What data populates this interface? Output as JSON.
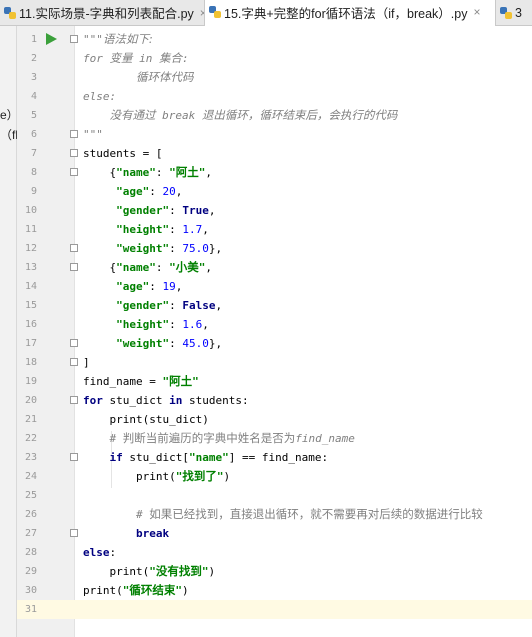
{
  "tabs": [
    {
      "label": "11.实际场景-字典和列表配合.py",
      "close": "×",
      "active": false
    },
    {
      "label": "15.字典+完整的for循环语法（if，break）.py",
      "close": "×",
      "active": true
    },
    {
      "label": "3",
      "active": false
    }
  ],
  "left_panel": {
    "fragments": [
      "e）",
      "（fl"
    ]
  },
  "colors": {
    "keyword": "#000080",
    "string": "#008000",
    "dict_key": "#660099",
    "number": "#0000ff",
    "comment": "#808080",
    "current_line": "#fffae3",
    "run_arrow": "#3ba03b"
  },
  "icons": [
    "python-file-icon",
    "run-arrow-icon",
    "fold-icon"
  ],
  "editor": {
    "current_line": 31,
    "lines": [
      {
        "n": "1",
        "t": [
          [
            "doc",
            "\"\"\""
          ],
          [
            "doc cjk",
            "语法如下:"
          ]
        ]
      },
      {
        "n": "2",
        "t": [
          [
            "doc",
            "for "
          ],
          [
            "doc cjk",
            "变量"
          ],
          [
            "doc",
            " in "
          ],
          [
            "doc cjk",
            "集合"
          ],
          [
            "doc",
            ":"
          ]
        ]
      },
      {
        "n": "3",
        "t": [
          [
            "doc",
            "        "
          ],
          [
            "doc cjk",
            "循环体代码"
          ]
        ]
      },
      {
        "n": "4",
        "t": [
          [
            "doc",
            "else:"
          ]
        ]
      },
      {
        "n": "5",
        "t": [
          [
            "doc",
            "    "
          ],
          [
            "doc cjk",
            "没有通过"
          ],
          [
            "doc",
            " break "
          ],
          [
            "doc cjk",
            "退出循环，循环结束后，会执行的代码"
          ]
        ]
      },
      {
        "n": "6",
        "t": [
          [
            "doc",
            "\"\"\""
          ]
        ]
      },
      {
        "n": "7",
        "t": [
          [
            "",
            "students = ["
          ]
        ]
      },
      {
        "n": "8",
        "t": [
          [
            "",
            "    {"
          ],
          [
            "str",
            "\"name\""
          ],
          [
            "",
            ": "
          ],
          [
            "str",
            "\""
          ],
          [
            "str cjk",
            "阿土"
          ],
          [
            "str",
            "\""
          ],
          [
            "",
            ","
          ]
        ]
      },
      {
        "n": "9",
        "t": [
          [
            "",
            "     "
          ],
          [
            "str",
            "\"age\""
          ],
          [
            "",
            ": "
          ],
          [
            "num",
            "20"
          ],
          [
            "",
            ","
          ]
        ]
      },
      {
        "n": "10",
        "t": [
          [
            "",
            "     "
          ],
          [
            "str",
            "\"gender\""
          ],
          [
            "",
            ": "
          ],
          [
            "kw",
            "True"
          ],
          [
            "",
            ","
          ]
        ]
      },
      {
        "n": "11",
        "t": [
          [
            "",
            "     "
          ],
          [
            "str",
            "\"height\""
          ],
          [
            "",
            ": "
          ],
          [
            "num",
            "1.7"
          ],
          [
            "",
            ","
          ]
        ]
      },
      {
        "n": "12",
        "t": [
          [
            "",
            "     "
          ],
          [
            "str",
            "\"weight\""
          ],
          [
            "",
            ": "
          ],
          [
            "num",
            "75.0"
          ],
          [
            "",
            "},"
          ]
        ]
      },
      {
        "n": "13",
        "t": [
          [
            "",
            "    {"
          ],
          [
            "str",
            "\"name\""
          ],
          [
            "",
            ": "
          ],
          [
            "str",
            "\""
          ],
          [
            "str cjk",
            "小美"
          ],
          [
            "str",
            "\""
          ],
          [
            "",
            ","
          ]
        ]
      },
      {
        "n": "14",
        "t": [
          [
            "",
            "     "
          ],
          [
            "str",
            "\"age\""
          ],
          [
            "",
            ": "
          ],
          [
            "num",
            "19"
          ],
          [
            "",
            ","
          ]
        ]
      },
      {
        "n": "15",
        "t": [
          [
            "",
            "     "
          ],
          [
            "str",
            "\"gender\""
          ],
          [
            "",
            ": "
          ],
          [
            "kw",
            "False"
          ],
          [
            "",
            ","
          ]
        ]
      },
      {
        "n": "16",
        "t": [
          [
            "",
            "     "
          ],
          [
            "str",
            "\"height\""
          ],
          [
            "",
            ": "
          ],
          [
            "num",
            "1.6"
          ],
          [
            "",
            ","
          ]
        ]
      },
      {
        "n": "17",
        "t": [
          [
            "",
            "     "
          ],
          [
            "str",
            "\"weight\""
          ],
          [
            "",
            ": "
          ],
          [
            "num",
            "45.0"
          ],
          [
            "",
            "},"
          ]
        ]
      },
      {
        "n": "18",
        "t": [
          [
            "",
            "]"
          ]
        ]
      },
      {
        "n": "19",
        "t": [
          [
            "",
            "find_name = "
          ],
          [
            "str",
            "\""
          ],
          [
            "str cjk",
            "阿土"
          ],
          [
            "str",
            "\""
          ]
        ]
      },
      {
        "n": "20",
        "t": [
          [
            "kw",
            "for"
          ],
          [
            "",
            " stu_dict "
          ],
          [
            "kw",
            "in"
          ],
          [
            "",
            " students:"
          ]
        ]
      },
      {
        "n": "21",
        "t": [
          [
            "",
            "    print(stu_dict)"
          ]
        ]
      },
      {
        "n": "22",
        "t": [
          [
            "cmt",
            "    # "
          ],
          [
            "cmt cjk",
            "判断当前遍历的字典中姓名是否为"
          ],
          [
            "cmt it",
            "find_name"
          ]
        ]
      },
      {
        "n": "23",
        "t": [
          [
            "",
            "    "
          ],
          [
            "kw",
            "if"
          ],
          [
            "",
            " stu_dict["
          ],
          [
            "str",
            "\"name\""
          ],
          [
            "",
            "] == find_name:"
          ]
        ]
      },
      {
        "n": "24",
        "t": [
          [
            "",
            "        print("
          ],
          [
            "str",
            "\""
          ],
          [
            "str cjk",
            "找到了"
          ],
          [
            "str",
            "\""
          ],
          [
            "",
            ")"
          ]
        ]
      },
      {
        "n": "25",
        "t": [
          [
            "",
            ""
          ]
        ]
      },
      {
        "n": "26",
        "t": [
          [
            "cmt",
            "        # "
          ],
          [
            "cmt cjk",
            "如果已经找到，直接退出循环，就不需要再对后续的数据进行比较"
          ]
        ]
      },
      {
        "n": "27",
        "t": [
          [
            "",
            "        "
          ],
          [
            "kw",
            "break"
          ]
        ]
      },
      {
        "n": "28",
        "t": [
          [
            "kw",
            "else"
          ],
          [
            "",
            ":"
          ]
        ]
      },
      {
        "n": "29",
        "t": [
          [
            "",
            "    print("
          ],
          [
            "str",
            "\""
          ],
          [
            "str cjk",
            "没有找到"
          ],
          [
            "str",
            "\""
          ],
          [
            "",
            ")"
          ]
        ]
      },
      {
        "n": "30",
        "t": [
          [
            "",
            "print("
          ],
          [
            "str",
            "\""
          ],
          [
            "str cjk",
            "循环结束"
          ],
          [
            "str",
            "\""
          ],
          [
            "",
            ")"
          ]
        ]
      },
      {
        "n": "31",
        "t": [
          [
            "",
            ""
          ]
        ]
      }
    ]
  }
}
